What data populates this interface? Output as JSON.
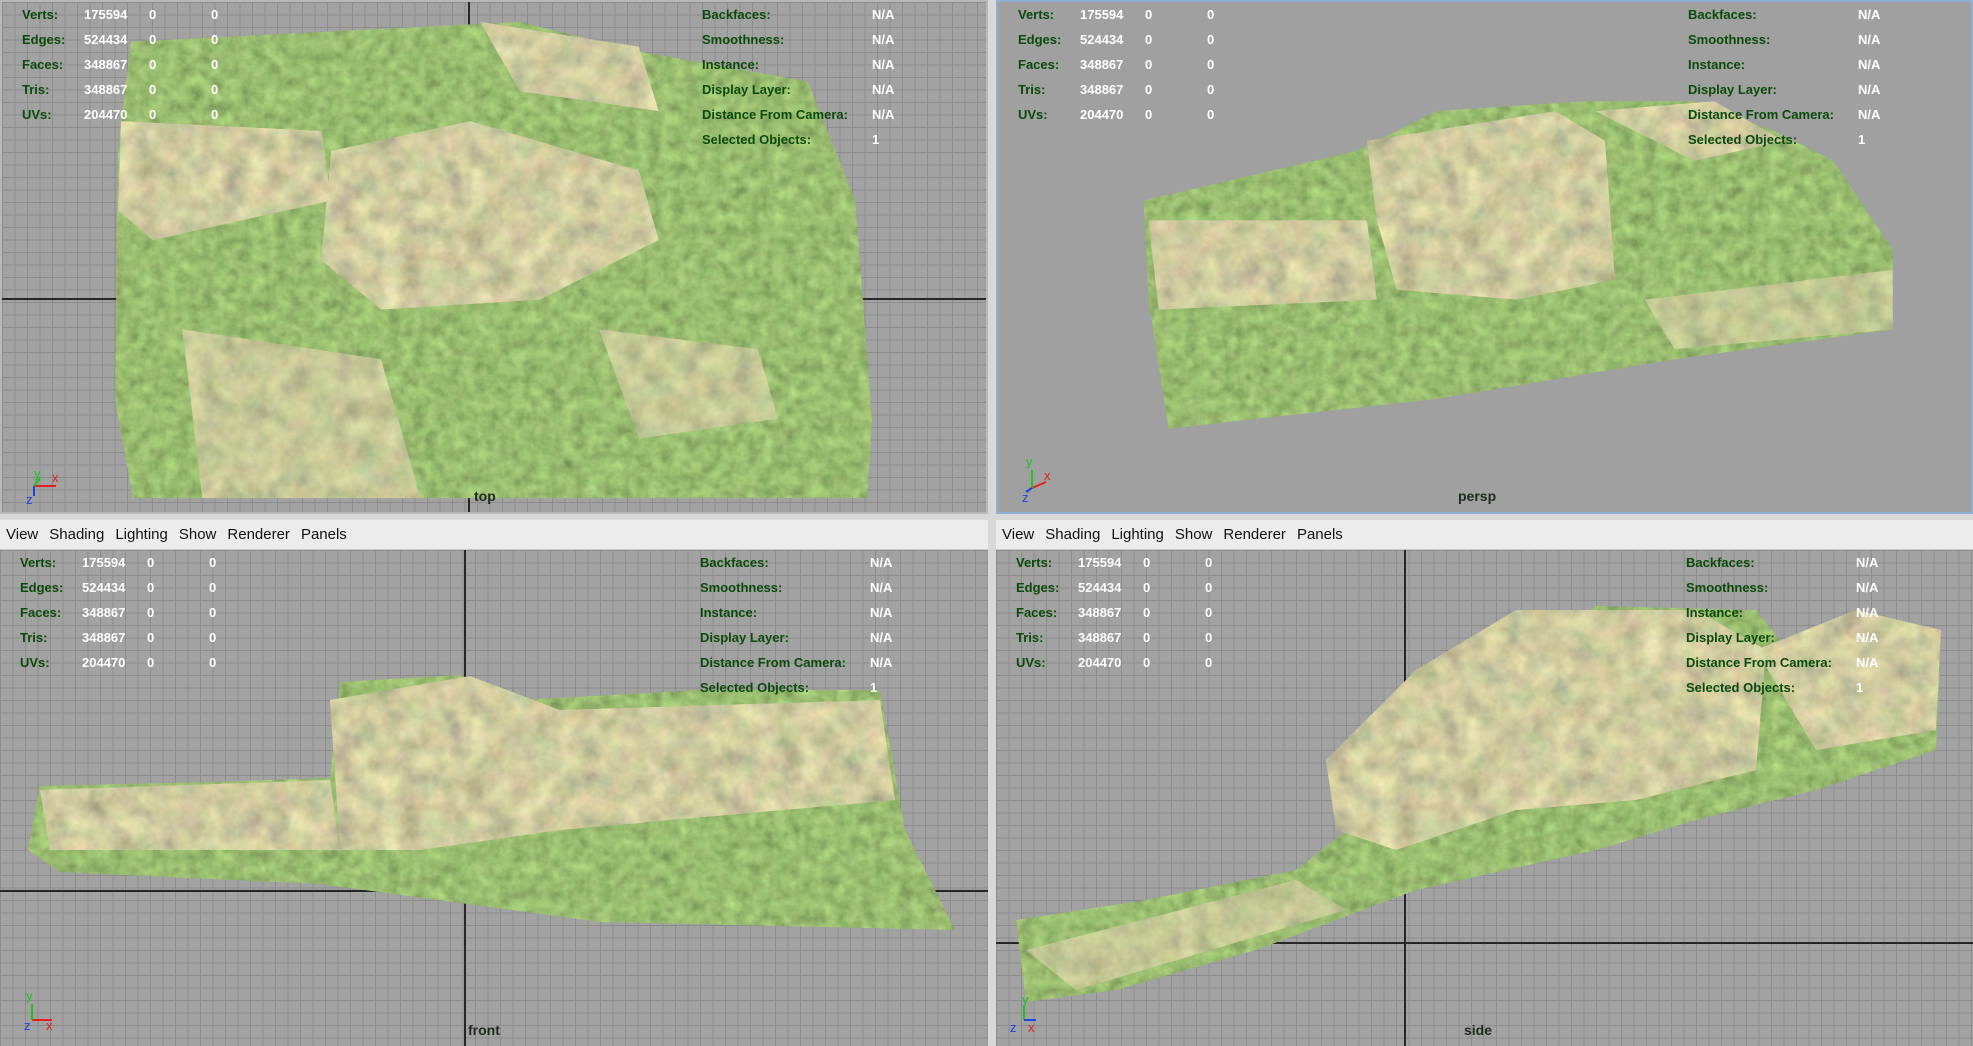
{
  "menus": [
    "View",
    "Shading",
    "Lighting",
    "Show",
    "Renderer",
    "Panels"
  ],
  "stats": [
    {
      "label": "Verts:",
      "count": "175594",
      "a": "0",
      "b": "0"
    },
    {
      "label": "Edges:",
      "count": "524434",
      "a": "0",
      "b": "0"
    },
    {
      "label": "Faces:",
      "count": "348867",
      "a": "0",
      "b": "0"
    },
    {
      "label": "Tris:",
      "count": "348867",
      "a": "0",
      "b": "0"
    },
    {
      "label": "UVs:",
      "count": "204470",
      "a": "0",
      "b": "0"
    }
  ],
  "props": [
    {
      "label": "Backfaces:",
      "value": "N/A"
    },
    {
      "label": "Smoothness:",
      "value": "N/A"
    },
    {
      "label": "Instance:",
      "value": "N/A"
    },
    {
      "label": "Display Layer:",
      "value": "N/A"
    },
    {
      "label": "Distance From Camera:",
      "value": "N/A"
    },
    {
      "label": "Selected Objects:",
      "value": "1"
    }
  ],
  "axes": {
    "x": "x",
    "y": "y",
    "z": "z"
  },
  "viewports": {
    "top": {
      "camera": "top"
    },
    "persp": {
      "camera": "persp"
    },
    "front": {
      "camera": "front"
    },
    "side": {
      "camera": "side"
    }
  },
  "colors": {
    "viewport_bg": "#a2a2a2",
    "grid_line": "#8c8c8c",
    "hud_label": "#0a4a0a",
    "hud_value": "#ffffff",
    "active_border": "#8fb0d4"
  }
}
